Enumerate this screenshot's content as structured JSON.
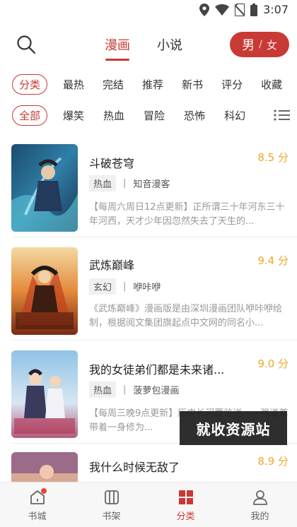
{
  "status_bar": {
    "time": "3:07",
    "icons": [
      "location-icon",
      "wifi-icon",
      "no-sim-icon",
      "battery-icon"
    ]
  },
  "header": {
    "tabs": [
      {
        "label": "漫画",
        "active": true
      },
      {
        "label": "小说",
        "active": false
      }
    ],
    "gender": {
      "active": "男",
      "separator": "/",
      "inactive": "女"
    },
    "search_icon": "search-icon"
  },
  "filters": {
    "sort_row": [
      "分类",
      "最热",
      "完结",
      "推荐",
      "新书",
      "评分",
      "收藏"
    ],
    "genre_row": [
      "全部",
      "爆笑",
      "热血",
      "冒险",
      "恐怖",
      "科幻"
    ],
    "list_icon": "list-icon"
  },
  "books": [
    {
      "title": "斗破苍穹",
      "score": "8.5 分",
      "genre": "热血",
      "author": "知音漫客",
      "description": "【每周六周日12点更新】正所谓三十年河东三十年河西，天才少年因忽然失去了天生的..."
    },
    {
      "title": "武炼巅峰",
      "score": "9.4 分",
      "genre": "玄幻",
      "author": "咿咔咿",
      "description": "《武炼巅峰》漫画版是由深圳漫画团队咿咔咿绘制，根据阅文集团旗起点中文网的同名小..."
    },
    {
      "title": "我的女徒弟们都是未来诸...",
      "score": "9.0 分",
      "genre": "热血",
      "author": "菠萝包漫画",
      "description": "【每周三晚9点更新】历史长河覆监送，一强道尊带着一身修为..."
    },
    {
      "title": "我什么时候无敌了",
      "score": "8.9 分",
      "genre": "",
      "author": "",
      "description": ""
    }
  ],
  "watermark": "就收资源站",
  "bottom_nav": [
    {
      "label": "书城",
      "icon": "home-icon",
      "active": false,
      "badge": true
    },
    {
      "label": "书架",
      "icon": "bookshelf-icon",
      "active": false,
      "badge": false
    },
    {
      "label": "分类",
      "icon": "category-grid-icon",
      "active": true,
      "badge": false
    },
    {
      "label": "我的",
      "icon": "profile-icon",
      "active": false,
      "badge": false
    }
  ],
  "colors": {
    "accent": "#c83a33",
    "score": "#f0a72c",
    "muted_text": "#999999"
  }
}
